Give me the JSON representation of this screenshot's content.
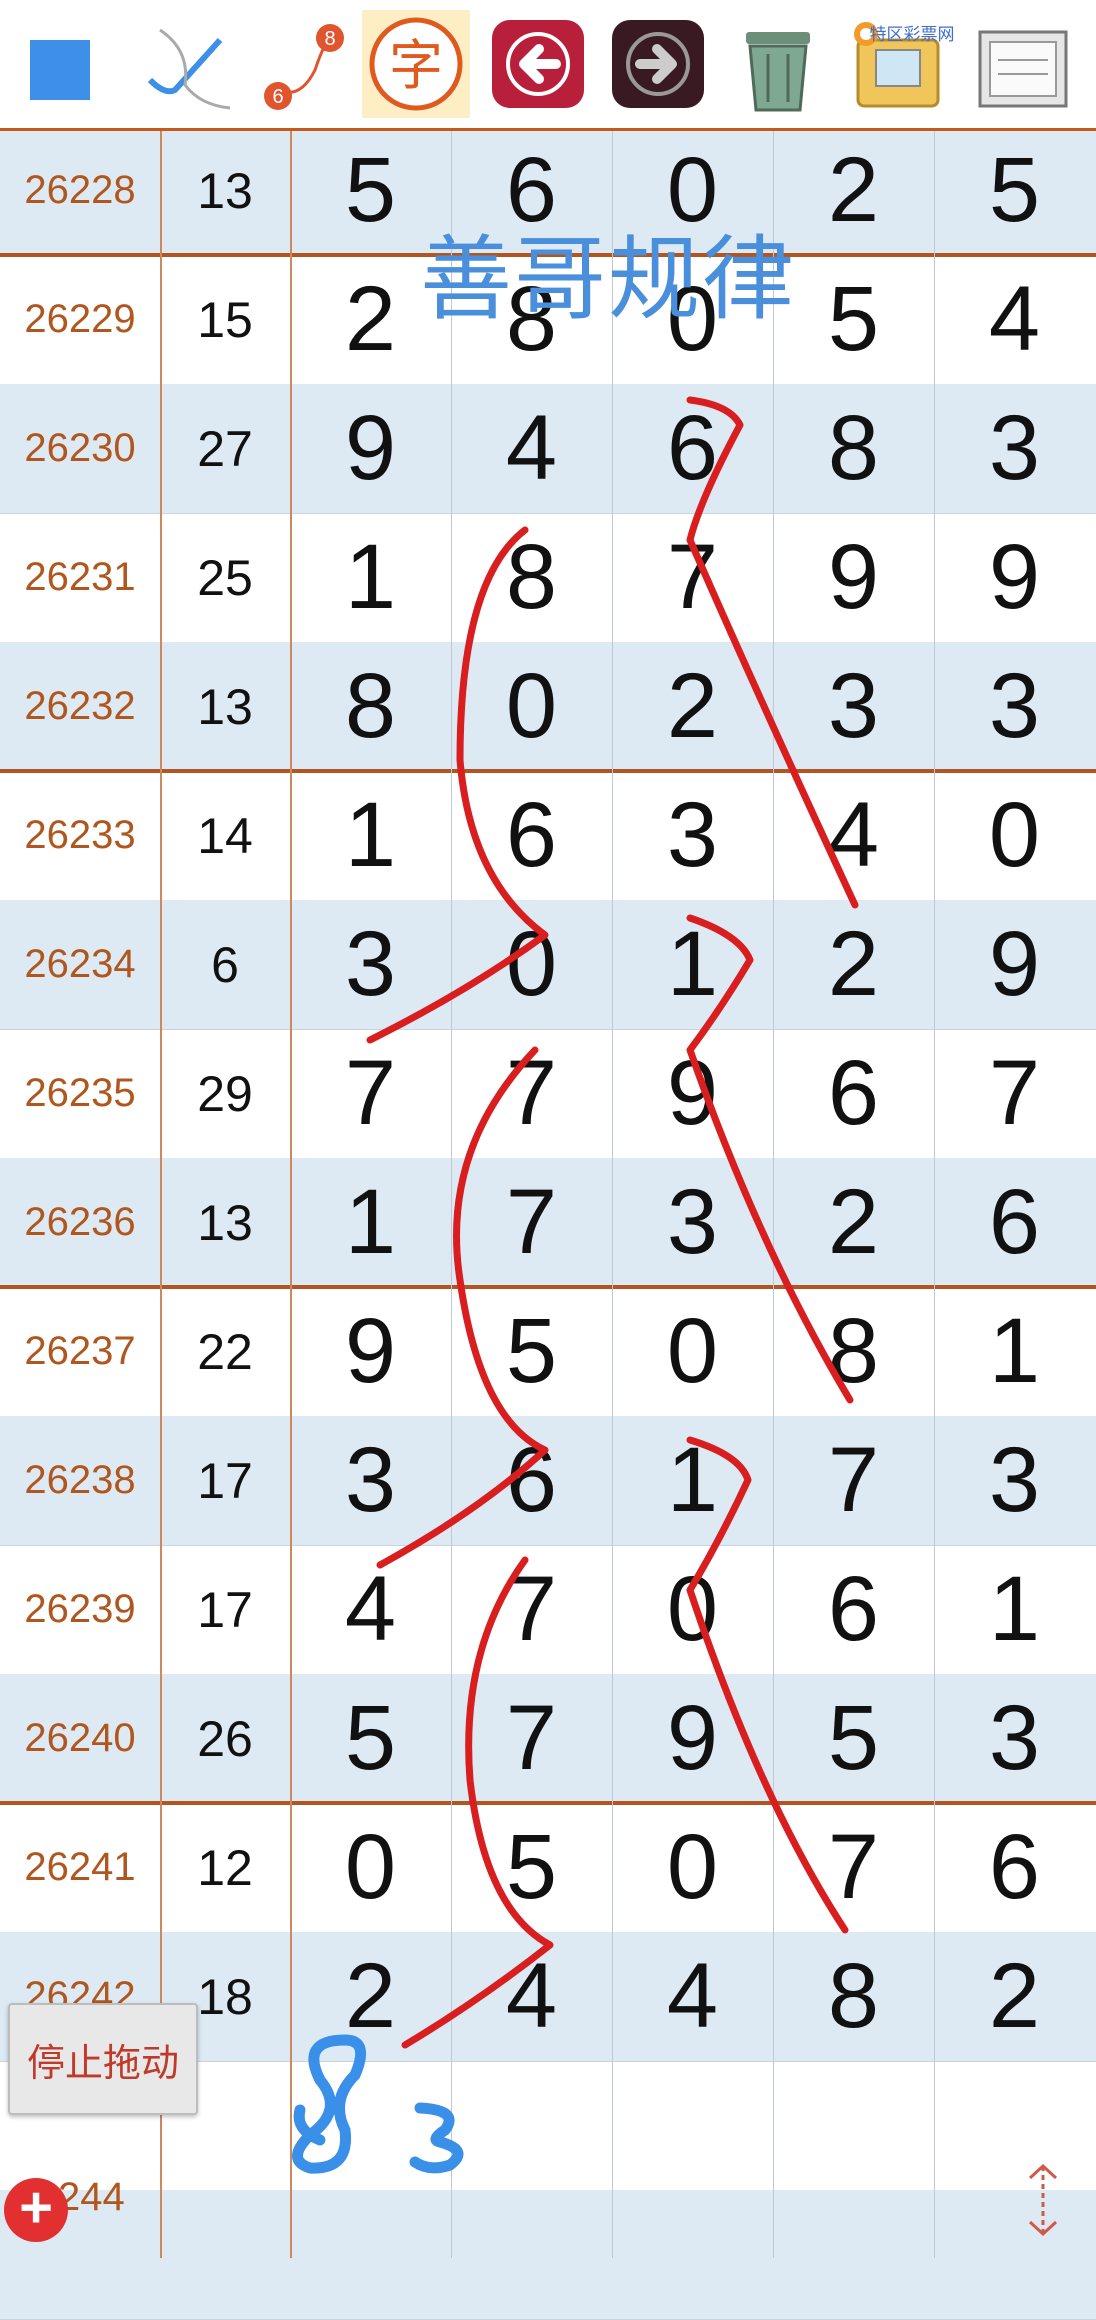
{
  "toolbar": {
    "items": [
      {
        "name": "blue-square-icon"
      },
      {
        "name": "check-pen-icon"
      },
      {
        "name": "line-draw-icon",
        "badge_start": "6",
        "badge_end": "8"
      },
      {
        "name": "text-char-icon",
        "glyph": "字"
      },
      {
        "name": "back-arrow-icon"
      },
      {
        "name": "forward-arrow-icon"
      },
      {
        "name": "trash-icon"
      },
      {
        "name": "photo-folder-icon",
        "logo_text": "特区彩票网"
      },
      {
        "name": "notebook-icon"
      }
    ]
  },
  "title": "善哥规律",
  "rows": [
    {
      "issue": "26228",
      "sum": "13",
      "digits": [
        "5",
        "6",
        "0",
        "2",
        "5"
      ]
    },
    {
      "issue": "26229",
      "sum": "15",
      "digits": [
        "2",
        "8",
        "0",
        "5",
        "4"
      ]
    },
    {
      "issue": "26230",
      "sum": "27",
      "digits": [
        "9",
        "4",
        "6",
        "8",
        "3"
      ]
    },
    {
      "issue": "26231",
      "sum": "25",
      "digits": [
        "1",
        "8",
        "7",
        "9",
        "9"
      ]
    },
    {
      "issue": "26232",
      "sum": "13",
      "digits": [
        "8",
        "0",
        "2",
        "3",
        "3"
      ]
    },
    {
      "issue": "26233",
      "sum": "14",
      "digits": [
        "1",
        "6",
        "3",
        "4",
        "0"
      ]
    },
    {
      "issue": "26234",
      "sum": "6",
      "digits": [
        "3",
        "0",
        "1",
        "2",
        "9"
      ]
    },
    {
      "issue": "26235",
      "sum": "29",
      "digits": [
        "7",
        "7",
        "9",
        "6",
        "7"
      ]
    },
    {
      "issue": "26236",
      "sum": "13",
      "digits": [
        "1",
        "7",
        "3",
        "2",
        "6"
      ]
    },
    {
      "issue": "26237",
      "sum": "22",
      "digits": [
        "9",
        "5",
        "0",
        "8",
        "1"
      ]
    },
    {
      "issue": "26238",
      "sum": "17",
      "digits": [
        "3",
        "6",
        "1",
        "7",
        "3"
      ]
    },
    {
      "issue": "26239",
      "sum": "17",
      "digits": [
        "4",
        "7",
        "0",
        "6",
        "1"
      ]
    },
    {
      "issue": "26240",
      "sum": "26",
      "digits": [
        "5",
        "7",
        "9",
        "5",
        "3"
      ]
    },
    {
      "issue": "26241",
      "sum": "12",
      "digits": [
        "0",
        "5",
        "0",
        "7",
        "6"
      ]
    },
    {
      "issue": "26242",
      "sum": "18",
      "digits": [
        "2",
        "4",
        "4",
        "8",
        "2"
      ]
    },
    {
      "issue": "",
      "sum": "",
      "digits": [
        "",
        "",
        "",
        "",
        ""
      ]
    },
    {
      "issue": "",
      "sum": "",
      "digits": [
        "",
        "",
        "",
        "",
        ""
      ]
    }
  ],
  "stop_button": "停止拖动",
  "bottom_issue": "244",
  "add_button": "+",
  "handwritten_note": "83",
  "colors": {
    "issue_text": "#b0561f",
    "shade_row": "#dde9f3",
    "separator": "#b35520",
    "annotation": "#d81e1e",
    "title_blue": "#4a8fdc"
  }
}
